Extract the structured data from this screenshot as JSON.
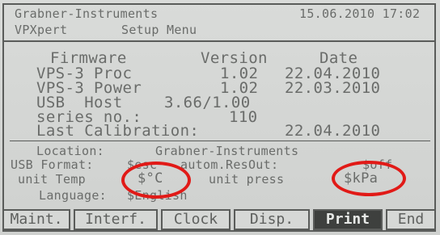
{
  "header": {
    "vendor": "Grabner-Instruments",
    "datetime": "15.06.2010 17:02",
    "product": "VPXpert",
    "menu": "Setup Menu"
  },
  "info_table": {
    "columns": [
      "Firmware",
      "Version",
      "Date"
    ],
    "rows": [
      {
        "name": "VPS-3 Proc",
        "version": "1.02",
        "date": "22.04.2010"
      },
      {
        "name": "VPS-3 Power",
        "version": "1.02",
        "date": "22.03.2010"
      },
      {
        "name": "USB  Host",
        "version": "3.66/1.00",
        "date": ""
      }
    ],
    "serial_label": "series no.:",
    "serial_value": "110"
  },
  "calibration": {
    "label": "Last Calibration:",
    "date": "22.04.2010"
  },
  "settings": {
    "location_label": "Location:",
    "location_value": "Grabner-Instruments",
    "usb_format_label": "USB Format:",
    "usb_format_value": "$esc",
    "usb_format_rest": "autom.ResOut:",
    "resout_value": "$off",
    "unit_temp_label": "unit Temp",
    "unit_temp_value": "$°C",
    "unit_press_label": "unit press",
    "unit_press_value": "$kPa",
    "language_label": "Language:",
    "language_value": "$English"
  },
  "softkeys": [
    {
      "label": "Maint.",
      "active": false
    },
    {
      "label": "Interf.",
      "active": false
    },
    {
      "label": "Clock",
      "active": false
    },
    {
      "label": "Disp.",
      "active": false
    },
    {
      "label": "Print",
      "active": true
    },
    {
      "label": "End",
      "active": false
    }
  ],
  "colors": {
    "annotation": "#e11a17",
    "lcd_background": "#d6d8d6",
    "lcd_text": "#6a6c6a"
  }
}
